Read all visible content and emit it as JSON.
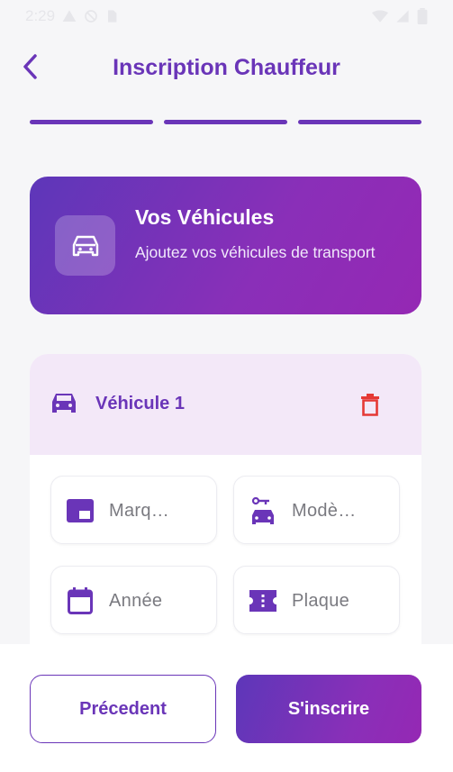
{
  "status_bar": {
    "time": "2:29"
  },
  "header": {
    "title": "Inscription Chauffeur"
  },
  "progress": {
    "steps_total": 3,
    "steps_done": 3,
    "color": "#6a35b8"
  },
  "banner": {
    "title": "Vos Véhicules",
    "subtitle": "Ajoutez vos véhicules de transport"
  },
  "vehicle": {
    "title": "Véhicule 1",
    "fields": {
      "marque": {
        "placeholder": "Marq…",
        "value": ""
      },
      "modele": {
        "placeholder": "Modè…",
        "value": ""
      },
      "annee": {
        "placeholder": "Année",
        "value": ""
      },
      "plaque": {
        "placeholder": "Plaque",
        "value": ""
      }
    }
  },
  "actions": {
    "previous_label": "Précedent",
    "submit_label": "S'inscrire"
  },
  "colors": {
    "accent": "#6a35b8",
    "accent2": "#9528b4",
    "delete": "#e53935"
  }
}
